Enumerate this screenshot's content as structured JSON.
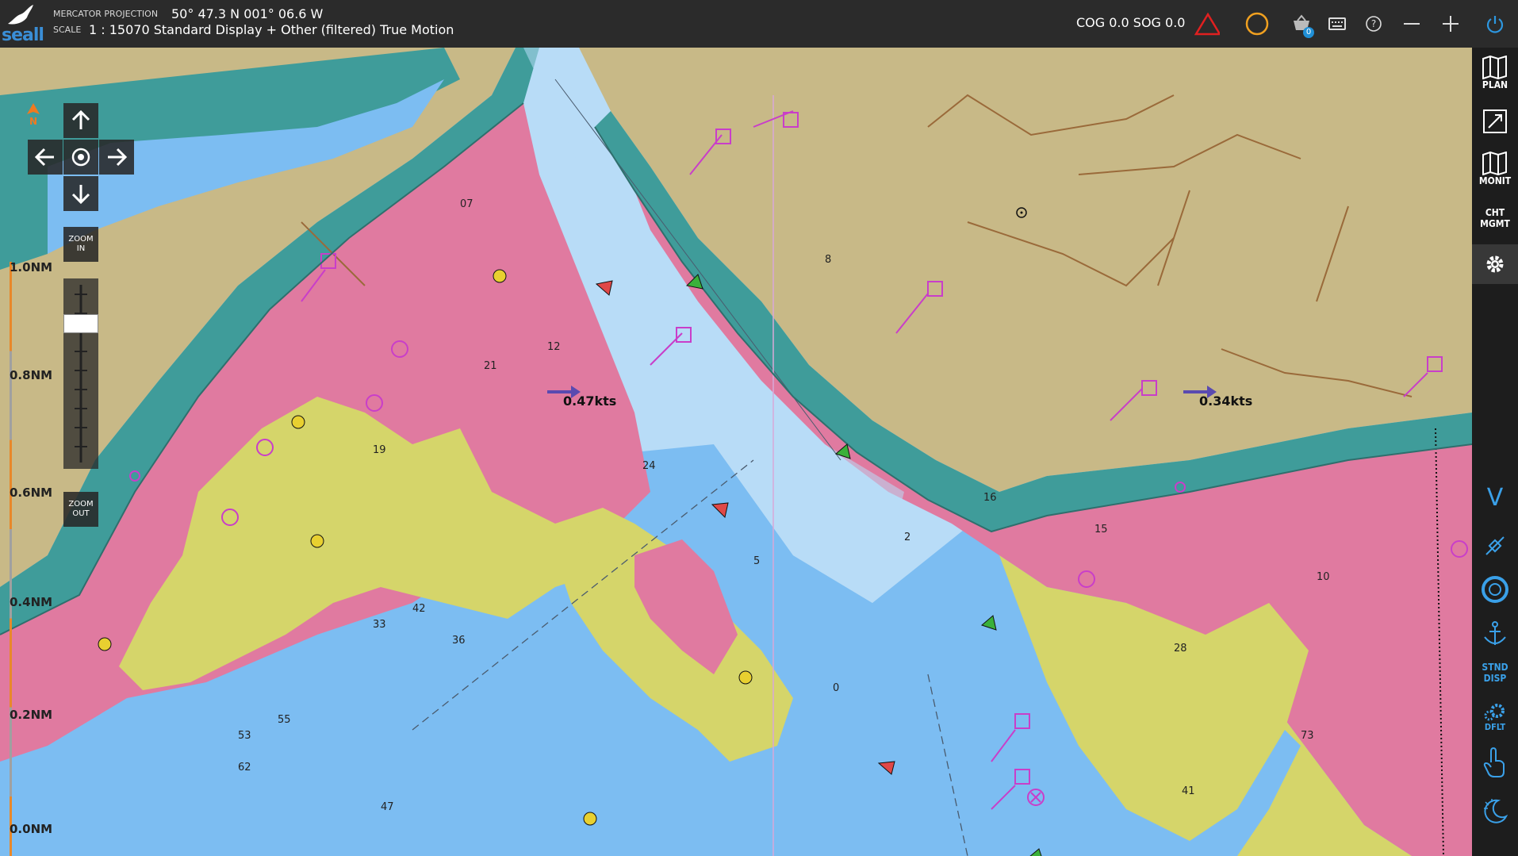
{
  "header": {
    "projection_label": "MERCATOR PROJECTION",
    "position": "50° 47.3 N 001° 06.6 W",
    "scale_label": "SCALE",
    "scale_value": "1 : 15070 Standard Display + Other (filtered) True Motion",
    "cog_sog": "COG 0.0  SOG 0.0",
    "basket_badge": "0",
    "logo_text": "seall"
  },
  "toolbar_icons": [
    "warning-triangle-icon",
    "alarm-circle-icon",
    "basket-icon",
    "keyboard-icon",
    "help-icon",
    "minimize-icon",
    "maximize-icon",
    "power-icon"
  ],
  "nav_controls": {
    "zoom_in": "ZOOM IN",
    "zoom_out": "ZOOM OUT",
    "north": "N"
  },
  "range_labels": [
    "1.0NM",
    "0.8NM",
    "0.6NM",
    "0.4NM",
    "0.2NM",
    "0.0NM"
  ],
  "speed_labels": [
    "0.47kts",
    "0.34kts"
  ],
  "sidebar": {
    "plan": "PLAN",
    "monit": "MONIT",
    "cht_mgmt_1": "CHT",
    "cht_mgmt_2": "MGMT",
    "stnd_disp_1": "STND",
    "stnd_disp_2": "DISP",
    "dflt": "DFLT",
    "v_label": "V"
  },
  "colors": {
    "land": "#c8b987",
    "shallow_pink": "#e07aa0",
    "drying_yellow": "#d5d56a",
    "shoal_blue": "#7cbdf2",
    "deep_blue": "#b8dcf7",
    "coast_teal": "#3f9c9a",
    "magenta": "#c93ec9"
  },
  "soundings": [
    "21",
    "12",
    "07",
    "19",
    "24",
    "42",
    "53",
    "36",
    "15",
    "10",
    "0",
    "2",
    "8",
    "16",
    "28",
    "33",
    "41",
    "47",
    "55",
    "62",
    "73",
    "5"
  ]
}
